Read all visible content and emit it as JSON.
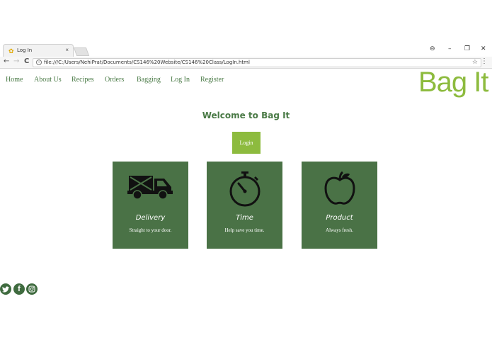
{
  "browser": {
    "tab_title": "Log In",
    "tab_close": "×",
    "url": "file:///C:/Users/NehiPrat/Documents/CS146%20Website/CS146%20Class/LogIn.html",
    "controls": {
      "account": "⊖",
      "minimize": "–",
      "restore": "❐",
      "close": "✕"
    },
    "nav": {
      "back": "←",
      "forward": "→",
      "reload": "C"
    },
    "omni_info": "i",
    "star": "☆",
    "menu": "⋮"
  },
  "nav": {
    "items": [
      {
        "label": "Home"
      },
      {
        "label": "About Us"
      },
      {
        "label": "Recipes"
      },
      {
        "label": "Orders"
      },
      {
        "label": "Bagging"
      },
      {
        "label": "Log In"
      },
      {
        "label": "Register"
      }
    ]
  },
  "logo": "Bag It",
  "welcome": "Welcome to Bag It",
  "login_label": "Login",
  "cards": [
    {
      "title": "Delivery",
      "text": "Straight to your door.",
      "icon": "truck-icon"
    },
    {
      "title": "Time",
      "text": "Help save you time.",
      "icon": "stopwatch-icon"
    },
    {
      "title": "Product",
      "text": "Always fresh.",
      "icon": "apple-icon"
    }
  ],
  "social": [
    {
      "icon": "twitter-icon"
    },
    {
      "icon": "facebook-icon",
      "glyph": "f"
    },
    {
      "icon": "instagram-icon"
    }
  ],
  "colors": {
    "primary": "#4a7246",
    "accent": "#8dbb3e",
    "nav_text": "#4a7a46"
  }
}
